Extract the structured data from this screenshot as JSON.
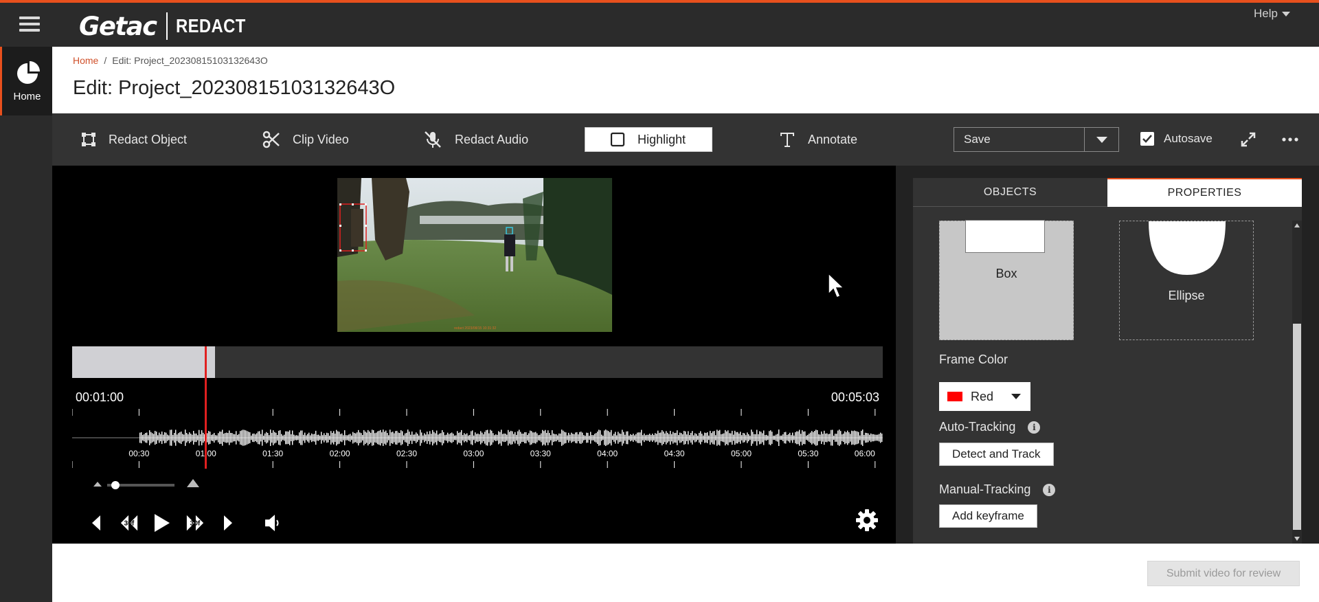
{
  "app": {
    "brand": "Getac",
    "product": "REDACT",
    "help_label": "Help"
  },
  "rail": {
    "home_label": "Home"
  },
  "breadcrumb": {
    "home": "Home",
    "separator": "/",
    "current": "Edit: Project_20230815103132643O"
  },
  "page": {
    "title": "Edit: Project_20230815103132643O"
  },
  "toolbar": {
    "tools": [
      {
        "label": "Redact Object",
        "icon": "box-select-icon"
      },
      {
        "label": "Clip Video",
        "icon": "scissors-icon"
      },
      {
        "label": "Redact Audio",
        "icon": "mic-off-icon"
      },
      {
        "label": "Highlight",
        "icon": "square-outline-icon",
        "active": true
      },
      {
        "label": "Annotate",
        "icon": "text-t-icon"
      }
    ],
    "save_label": "Save",
    "autosave_label": "Autosave",
    "autosave_checked": true
  },
  "player": {
    "time_current": "00:01:00",
    "time_total": "00:05:03",
    "timeline_progress": 0.176,
    "ruler_labels": [
      "00:30",
      "01:00",
      "01:30",
      "02:00",
      "02:30",
      "03:00",
      "03:30",
      "04:00",
      "04:30",
      "05:00",
      "05:30",
      "06:00"
    ],
    "frame_step_label": "30f",
    "controls": [
      "prev-frame-icon",
      "rewind-30f-icon",
      "play-icon",
      "forward-30f-icon",
      "next-frame-icon",
      "volume-icon"
    ]
  },
  "panel": {
    "tabs": [
      {
        "label": "OBJECTS",
        "active": false
      },
      {
        "label": "PROPERTIES",
        "active": true
      }
    ],
    "shapes": [
      {
        "label": "Box",
        "selected": true
      },
      {
        "label": "Ellipse",
        "selected": false
      }
    ],
    "frame_color_label": "Frame Color",
    "frame_color_value": "Red",
    "frame_color_hex": "#ff0000",
    "auto_tracking_label": "Auto-Tracking",
    "detect_track_label": "Detect and Track",
    "manual_tracking_label": "Manual-Tracking",
    "add_keyframe_label": "Add keyframe"
  },
  "footer": {
    "submit_label": "Submit video for review"
  },
  "colors": {
    "accent": "#e8501d",
    "toolbar_bg": "#333333",
    "playhead": "#e02020"
  }
}
